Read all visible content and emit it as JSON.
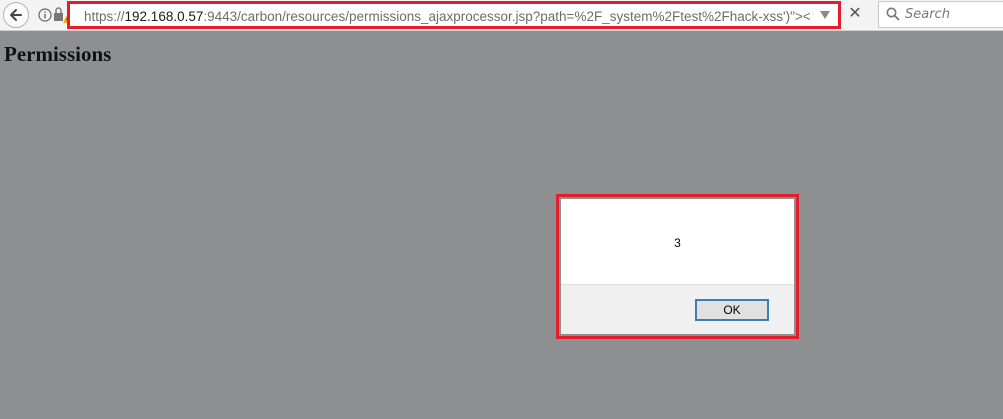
{
  "toolbar": {
    "url": {
      "scheme": "https://",
      "host": "192.168.0.57",
      "rest": ":9443/carbon/resources/permissions_ajaxprocessor.jsp?path=%2F_system%2Ftest%2Fhack-xss')\"><"
    },
    "search": {
      "placeholder": "Search"
    },
    "icons": [
      "back-arrow-icon",
      "info-icon",
      "lock-warning-icon",
      "dropdown-arrow-icon",
      "close-icon",
      "search-icon"
    ]
  },
  "page": {
    "title": "Permissions"
  },
  "dialog": {
    "message": "3",
    "ok_label": "OK"
  },
  "colors": {
    "highlight": "#e21d2c",
    "overlay": "#8e8f91",
    "ok_border": "#3c7fb1"
  }
}
